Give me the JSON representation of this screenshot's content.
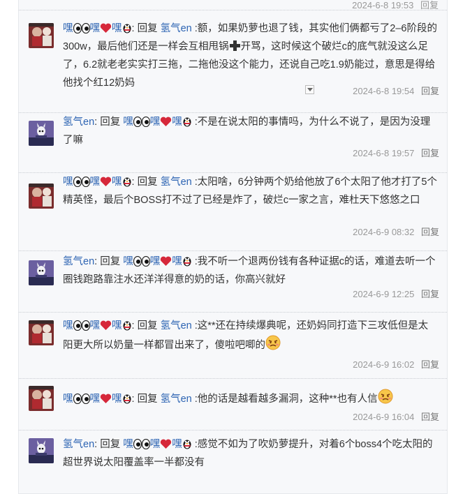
{
  "top_meta": {
    "timestamp": "2024-6-8 19:53",
    "reply_label": "回复"
  },
  "names": {
    "hei": "嘿",
    "qq": "氢气en"
  },
  "reply_word": "回复",
  "comments": [
    {
      "author": "hei",
      "target": "qq",
      "text": ":额，如果奶萝也退了钱，其实他们俩都亏了2–6阶段的300w，最后他们还是一样会互相甩锅",
      "text_after_plus": "开骂，这时候这个破烂c的底气就没这么足了，6.2就老老实实打三拖，二拖他没这个能力，还说自己吃1.9奶能过，意思是得给他找个红12奶妈",
      "timestamp": "2024-6-8 19:54",
      "reply_label": "回复"
    },
    {
      "author": "qq",
      "target": "hei",
      "text": ":不是在说太阳的事情吗，为什么不说了，是因为没理了嘛",
      "timestamp": "2024-6-8 19:57",
      "reply_label": "回复"
    },
    {
      "author": "hei",
      "target": "qq",
      "text": ":太阳啥，6分钟两个奶给他放了6个太阳了他才打了5个精英怪，最后个BOSS打不过了已经是炸了，破烂c一家之言，难杜天下悠悠之口",
      "timestamp": "2024-6-9 08:32",
      "reply_label": "回复"
    },
    {
      "author": "qq",
      "target": "hei",
      "text": ":我不听一个退两份钱有各种证据c的话，难道去听一个圈钱跑路靠注水还洋洋得意的奶的话，你高兴就好",
      "timestamp": "2024-6-9 12:25",
      "reply_label": "回复"
    },
    {
      "author": "hei",
      "target": "qq",
      "text": ":这**还在持续爆典呢，还奶妈同打造下三攻低但是太阳更大所以奶量一样都冒出来了，傻啦吧唧的",
      "timestamp": "2024-6-9 16:02",
      "reply_label": "回复"
    },
    {
      "author": "hei",
      "target": "qq",
      "text": ":他的话是越看越多漏洞，这种**也有人信",
      "timestamp": "2024-6-9 16:04",
      "reply_label": "回复"
    },
    {
      "author": "qq",
      "target": "hei",
      "text": ":感觉不如为了吹奶萝提升，对着6个boss4个吃太阳的超世界说太阳覆盖率一半都没有",
      "timestamp": "",
      "reply_label": ""
    }
  ]
}
